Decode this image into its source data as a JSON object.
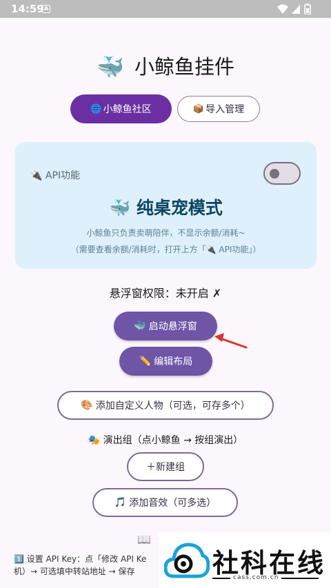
{
  "status_bar": {
    "time": "14:59",
    "notif_glyph": "A"
  },
  "header": {
    "logo_emoji": "🐳",
    "title": "小鲸鱼挂件"
  },
  "tabs": [
    {
      "icon": "🌐",
      "label": "小鲸鱼社区",
      "active": true
    },
    {
      "icon": "📦",
      "label": "导入管理",
      "active": false
    }
  ],
  "mode_card": {
    "api_icon": "🔌",
    "api_label": "API功能",
    "api_toggle_on": false,
    "title_emoji": "🐳",
    "title": "纯桌宠模式",
    "desc_line1": "小鲸鱼只负责卖萌陪伴，不显示余额/消耗~",
    "desc_line2": "（需要查看余额/消耗时，打开上方「🔌 API功能」）"
  },
  "float_permission": "悬浮窗权限：未开启 ✗",
  "buttons": {
    "start_float": {
      "icon": "🐳",
      "label": "启动悬浮窗"
    },
    "edit_layout": {
      "icon": "✏️",
      "label": "编辑布局"
    },
    "add_character": {
      "icon": "🎨",
      "label": "添加自定义人物（可选，可存多个）"
    },
    "new_group": {
      "label": "＋新建组"
    },
    "add_sound": {
      "icon": "🎵",
      "label": "添加音效（可多选）"
    }
  },
  "show_group_label": "🎭 演出组（点小鲸鱼 → 按组演出）",
  "bottom": {
    "icon": "📖",
    "step1_line1": "1️⃣ 设置 API Key：点「修改 API Ke",
    "step1_line2": "机）→ 可选填中转站地址 → 保存"
  },
  "watermark": {
    "text": "社科在线",
    "url": "cass.com.cn"
  },
  "colors": {
    "primary": "#6e55a6",
    "active_tab": "#6b2fa3",
    "card_bg": "#ddf0fb",
    "arrow": "#d9362b"
  }
}
